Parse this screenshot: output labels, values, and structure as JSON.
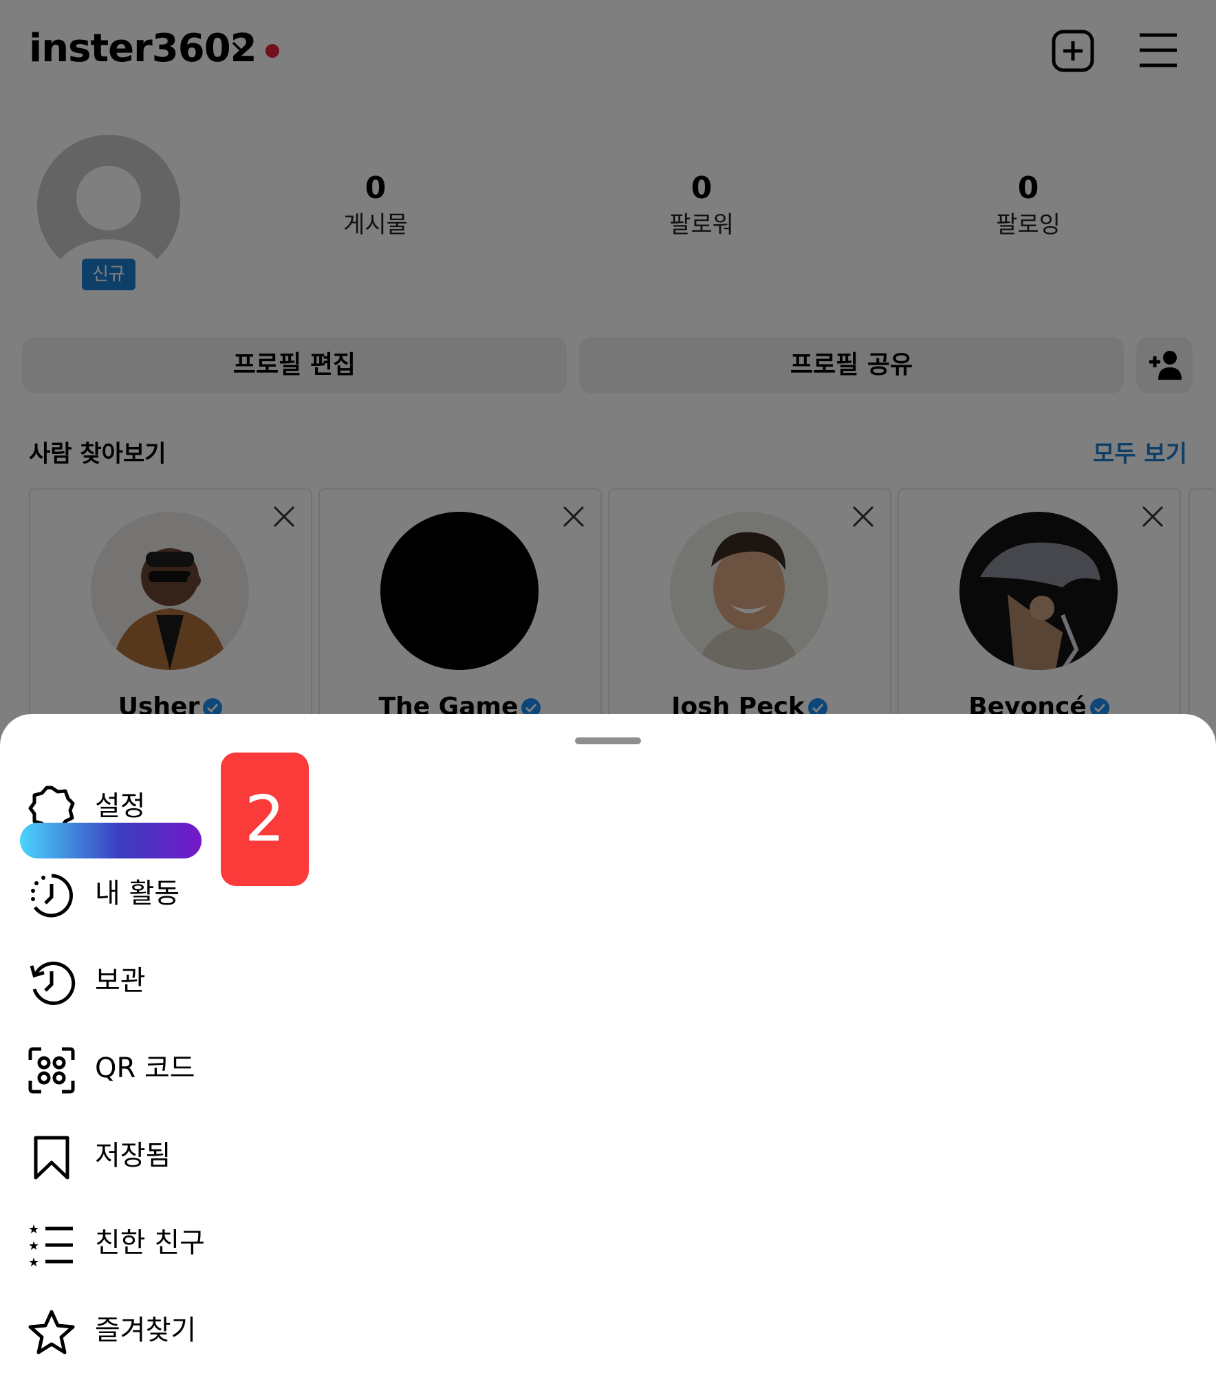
{
  "header": {
    "username": "inster3602",
    "chevron_icon": "chevron-down-icon",
    "dot_color": "#e0243a",
    "new_post_icon": "plus-square-icon",
    "menu_icon": "hamburger-menu-icon"
  },
  "profile": {
    "avatar_icon": "default-avatar-icon",
    "badge": "신규",
    "stats": [
      {
        "value": "0",
        "label": "게시물"
      },
      {
        "value": "0",
        "label": "팔로워"
      },
      {
        "value": "0",
        "label": "팔로잉"
      }
    ],
    "buttons": {
      "edit": "프로필 편집",
      "share": "프로필 공유",
      "discover_icon": "add-person-icon"
    }
  },
  "discover": {
    "title": "사람 찾아보기",
    "see_all": "모두 보기",
    "cards": [
      {
        "name": "Usher",
        "verified": true
      },
      {
        "name": "The Game",
        "verified": true
      },
      {
        "name": "Josh Peck",
        "verified": true
      },
      {
        "name": "Beyoncé",
        "verified": true
      }
    ]
  },
  "sheet": {
    "items": [
      {
        "label": "설정",
        "icon": "settings-gear-icon"
      },
      {
        "label": "내 활동",
        "icon": "activity-clock-icon"
      },
      {
        "label": "보관",
        "icon": "archive-history-icon"
      },
      {
        "label": "QR 코드",
        "icon": "qr-code-icon"
      },
      {
        "label": "저장됨",
        "icon": "bookmark-icon"
      },
      {
        "label": "친한 친구",
        "icon": "close-friends-list-icon"
      },
      {
        "label": "즐겨찾기",
        "icon": "star-icon"
      }
    ]
  },
  "annotation": {
    "step": "2"
  },
  "colors": {
    "link": "#1a7fd0",
    "badge": "#1a7fd0",
    "step_badge": "#fb3a3a",
    "highlight_gradient": [
      "#4ad5fb",
      "#3a3ec0",
      "#7418c8"
    ]
  }
}
